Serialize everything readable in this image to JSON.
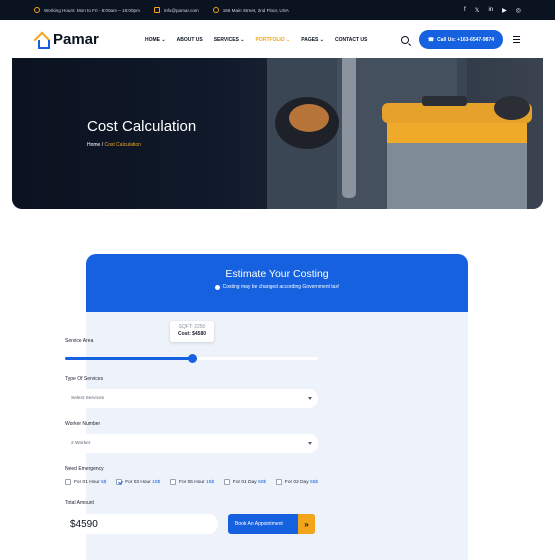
{
  "topbar": {
    "hours": "Working Hours: Mon to Fri - 8:00am – 18:00pm",
    "email": "info@pamar.com",
    "address": "156 Main Street, 2nd Floor, USA",
    "social": [
      "f",
      "𝕏",
      "in",
      "▶",
      "◎"
    ]
  },
  "header": {
    "logo": "Pamar",
    "nav": [
      "HOME ⌄",
      "ABOUT US",
      "SERVICES ⌄",
      "PORTFOLIO ⌄",
      "PAGES ⌄",
      "CONTACT US"
    ],
    "call": "Call Us: +163-6547-9874"
  },
  "hero": {
    "title": "Cost Calculation",
    "crumb_home": "Home",
    "crumb_sep": " / ",
    "crumb_current": "Cost Calculation"
  },
  "calculator": {
    "title": "Estimate Your Costing",
    "note": "Costing may be changed according Government tax!",
    "service_area_label": "Service Area",
    "slider_tooltip_sqft": "SQFT: 2250",
    "slider_tooltip_cost": "Cost: $4580",
    "slider_fraction": 0.5,
    "type_label": "Type Of Services",
    "type_value": "Select Services",
    "worker_label": "Worker Number",
    "worker_value": "2 Worker",
    "emergency_label": "Need Emergency",
    "emergency_options": [
      {
        "label": "For 01 Hour ",
        "price": "5$",
        "checked": false
      },
      {
        "label": "For 03 Hour ",
        "price": "10$",
        "checked": true
      },
      {
        "label": "For 05 Hour ",
        "price": "15$",
        "checked": false
      },
      {
        "label": "For 01 Day ",
        "price": "50$",
        "checked": false
      },
      {
        "label": "For 02 Day ",
        "price": "55$",
        "checked": false
      }
    ],
    "total_label": "Total Amount",
    "total_value": "$4590",
    "book_label": "Book An Appointment",
    "book_arrow": "»"
  },
  "colors": {
    "primary": "#1561e0",
    "accent": "#f2a51a",
    "dark": "#0b1220"
  }
}
